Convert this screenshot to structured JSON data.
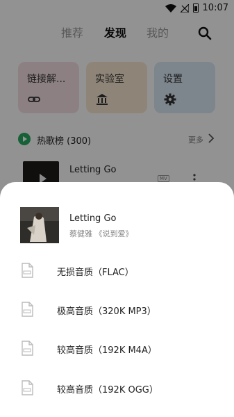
{
  "status_bar": {
    "time": "10:07"
  },
  "topnav": {
    "tabs": [
      "推荐",
      "发现",
      "我的"
    ],
    "active_tab": "发现"
  },
  "feature_cards": [
    {
      "label": "链接解...",
      "icon": "link-icon"
    },
    {
      "label": "实验室",
      "icon": "bank-icon"
    },
    {
      "label": "设置",
      "icon": "gear-icon"
    }
  ],
  "hot_chart": {
    "title": "热歌榜 (300)",
    "more_label": "更多"
  },
  "hot_song": {
    "name": "Letting Go",
    "badge": "MV"
  },
  "sheet": {
    "song_title": "Letting Go",
    "song_subtitle": "蔡健雅 《说到爱》",
    "options": [
      {
        "label": "无损音质（FLAC）",
        "icon": "file-icon"
      },
      {
        "label": "极高音质（320K MP3）",
        "icon": "file-icon"
      },
      {
        "label": "较高音质（192K M4A）",
        "icon": "file-icon"
      },
      {
        "label": "较高音质（192K OGG）",
        "icon": "file-icon"
      }
    ]
  },
  "colors": {
    "overlay": "#8f8f8f",
    "accent_green": "#27a760",
    "sheet_bg": "#ffffff"
  }
}
